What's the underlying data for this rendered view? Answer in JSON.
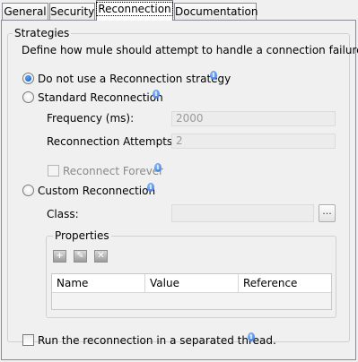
{
  "tabs": [
    {
      "label": "General"
    },
    {
      "label": "Security"
    },
    {
      "label": "Reconnection"
    },
    {
      "label": "Documentation"
    }
  ],
  "strategies": {
    "legend": "Strategies",
    "description": "Define how mule should attempt to handle a connection failure",
    "options": {
      "none": {
        "label": "Do not use a Reconnection strategy",
        "selected": true
      },
      "standard": {
        "label": "Standard Reconnection",
        "selected": false
      },
      "custom": {
        "label": "Custom Reconnection",
        "selected": false
      }
    },
    "frequency": {
      "label": "Frequency (ms):",
      "value": "2000"
    },
    "attempts": {
      "label": "Reconnection Attempts:",
      "value": "2"
    },
    "forever": {
      "label": "Reconnect Forever",
      "checked": false
    },
    "class": {
      "label": "Class:",
      "value": "",
      "browse_label": "..."
    }
  },
  "properties": {
    "legend": "Properties",
    "toolbar": [
      {
        "icon": "add-icon"
      },
      {
        "icon": "edit-icon"
      },
      {
        "icon": "delete-icon"
      }
    ],
    "columns": [
      "Name",
      "Value",
      "Reference"
    ],
    "rows": []
  },
  "thread": {
    "label": "Run the reconnection in a separated thread.",
    "checked": false
  },
  "info_glyph": "i"
}
